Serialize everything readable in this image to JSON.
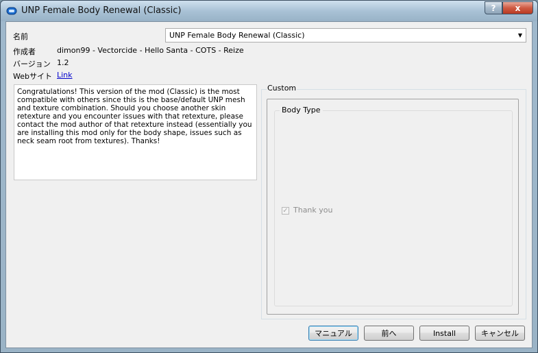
{
  "window": {
    "title": "UNP Female Body Renewal (Classic)",
    "help_glyph": "?",
    "close_glyph": "x"
  },
  "form": {
    "name_label": "名前",
    "name_value": "UNP Female Body Renewal (Classic)",
    "author_label": "作成者",
    "author_value": "dimon99 - Vectorcide - Hello Santa - COTS - Reize",
    "version_label": "バージョン",
    "version_value": "1.2",
    "website_label": "Webサイト",
    "website_link": "Link"
  },
  "description": "Congratulations! This version of the mod (Classic) is the most compatible with others since this is the base/default UNP mesh and texture combination. Should you choose another skin retexture and you encounter issues with that retexture, please contact the mod author of that retexture instead (essentially you are installing this mod only for the body shape, issues such as neck seam root from textures). Thanks!",
  "custom": {
    "group_label": "Custom",
    "body_type_label": "Body Type",
    "option_label": "Thank you",
    "option_checked": true
  },
  "buttons": {
    "manual": "マニュアル",
    "back": "前へ",
    "install": "Install",
    "cancel": "キャンセル"
  },
  "icons": {
    "app": "mod-organizer-icon",
    "dropdown": "chevron-down-icon"
  }
}
